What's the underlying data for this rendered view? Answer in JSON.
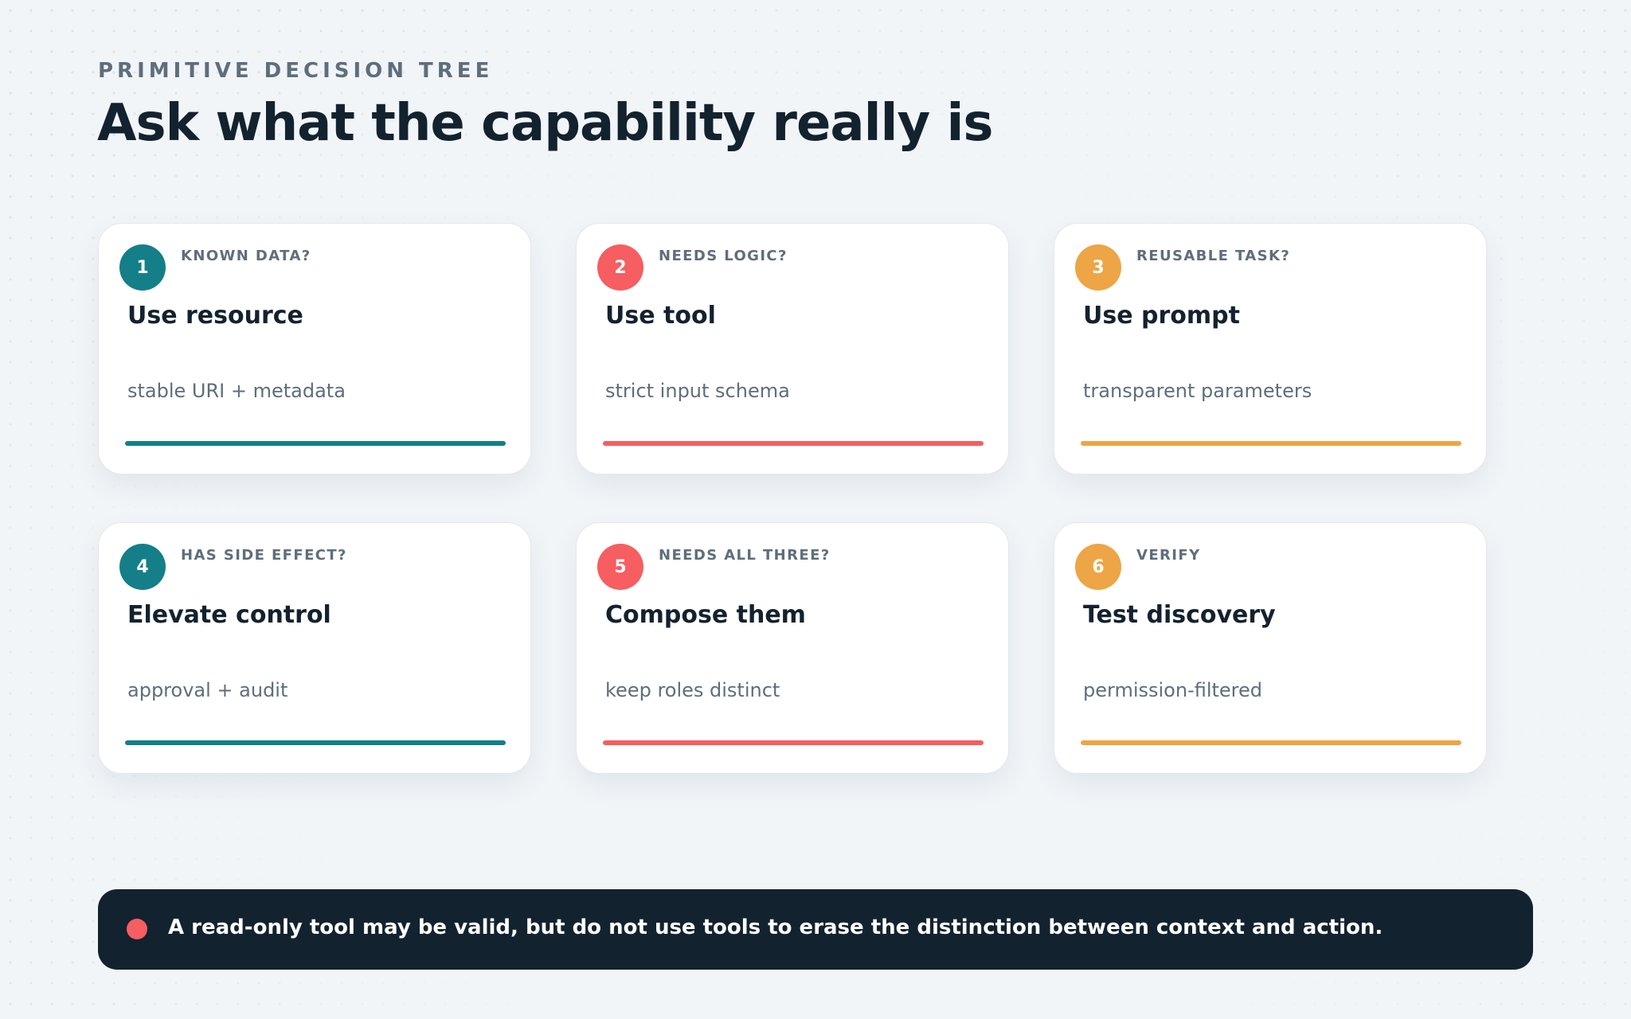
{
  "header": {
    "eyebrow": "PRIMITIVE DECISION TREE",
    "title": "Ask what the capability really is"
  },
  "colors": {
    "teal": "#147f88",
    "coral": "#f65e61",
    "amber": "#eda545",
    "navy": "#13222f",
    "background": "#f2f5f8"
  },
  "cards": [
    {
      "number": "1",
      "question": "KNOWN DATA?",
      "action": "Use resource",
      "detail": "stable URI + metadata",
      "color": "teal"
    },
    {
      "number": "2",
      "question": "NEEDS LOGIC?",
      "action": "Use tool",
      "detail": "strict input schema",
      "color": "coral"
    },
    {
      "number": "3",
      "question": "REUSABLE TASK?",
      "action": "Use prompt",
      "detail": "transparent parameters",
      "color": "amber"
    },
    {
      "number": "4",
      "question": "HAS SIDE EFFECT?",
      "action": "Elevate control",
      "detail": "approval + audit",
      "color": "teal"
    },
    {
      "number": "5",
      "question": "NEEDS ALL THREE?",
      "action": "Compose them",
      "detail": "keep roles distinct",
      "color": "coral"
    },
    {
      "number": "6",
      "question": "VERIFY",
      "action": "Test discovery",
      "detail": "permission-filtered",
      "color": "amber"
    }
  ],
  "note": {
    "text": "A read-only tool may be valid, but do not use tools to erase the distinction between context and action."
  }
}
